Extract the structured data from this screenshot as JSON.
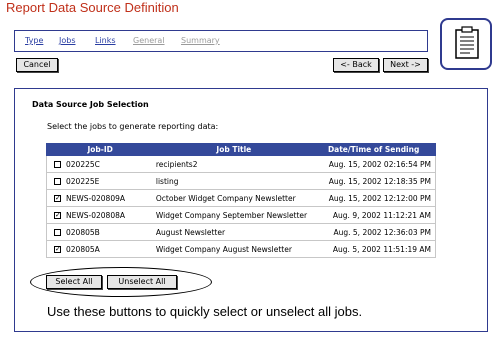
{
  "page": {
    "title": "Report Data Source Definition"
  },
  "tabs": [
    {
      "label": "Type",
      "enabled": true
    },
    {
      "label": "Jobs",
      "enabled": true
    },
    {
      "label": "Links",
      "enabled": true
    },
    {
      "label": "General",
      "enabled": false
    },
    {
      "label": "Summary",
      "enabled": false
    }
  ],
  "toolbar": {
    "cancel_label": "Cancel",
    "back_label": "<- Back",
    "next_label": "Next ->"
  },
  "panel": {
    "heading": "Data Source Job Selection",
    "instruction": "Select the jobs to generate reporting data:"
  },
  "table": {
    "headers": {
      "job_id": "Job-ID",
      "job_title": "Job Title",
      "date": "Date/Time of Sending"
    },
    "rows": [
      {
        "checked": false,
        "job_id": "020225C",
        "title": "recipients2",
        "date": "Aug. 15, 2002 02:16:54 PM"
      },
      {
        "checked": false,
        "job_id": "020225E",
        "title": "listing",
        "date": "Aug. 15, 2002 12:18:35 PM"
      },
      {
        "checked": true,
        "job_id": "NEWS-020809A",
        "title": "October Widget Company Newsletter",
        "date": "Aug. 15, 2002 12:12:00 PM"
      },
      {
        "checked": true,
        "job_id": "NEWS-020808A",
        "title": "Widget Company September Newsletter",
        "date": "Aug. 9, 2002 11:12:21 AM"
      },
      {
        "checked": false,
        "job_id": "020805B",
        "title": "August Newsletter",
        "date": "Aug. 5, 2002 12:36:03 PM"
      },
      {
        "checked": true,
        "job_id": "020805A",
        "title": "Widget Company August Newsletter",
        "date": "Aug. 5, 2002 11:51:19 AM"
      }
    ]
  },
  "selection": {
    "select_all_label": "Select All",
    "unselect_all_label": "Unselect All"
  },
  "annotation": {
    "text": "Use these buttons to quickly select or unselect all jobs."
  },
  "icons": {
    "wizard_icon": "document-report-icon"
  },
  "colors": {
    "title_red": "#c0301a",
    "header_blue": "#34499a",
    "link_blue": "#2a3ea3",
    "border_blue": "#2f3a8f"
  }
}
